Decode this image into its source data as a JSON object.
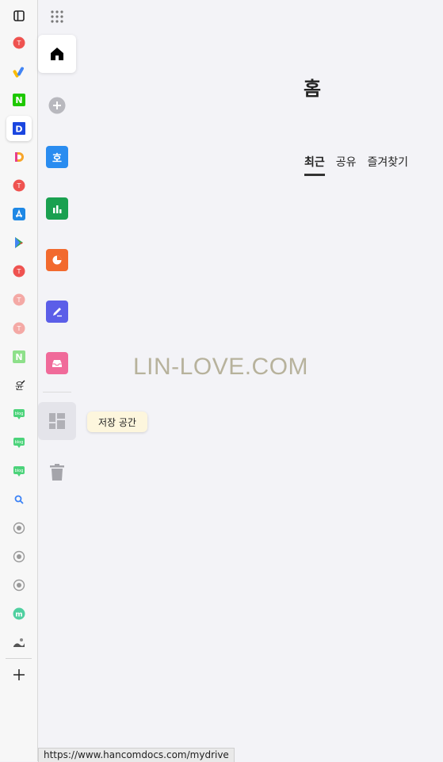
{
  "browser_sidebar": {
    "icons": [
      "sidebar-toggle-icon",
      "favicon-red-icon",
      "google-ads-icon",
      "naver-icon",
      "d-app-icon",
      "d-gradient-icon",
      "favicon-red-icon",
      "app-store-icon",
      "google-play-icon",
      "favicon-red-icon",
      "favicon-red-faded-icon",
      "favicon-red-faded-icon",
      "naver-faded-icon",
      "text-app-icon",
      "blog-icon",
      "blog-icon",
      "blog-icon",
      "search-icon",
      "radio-icon",
      "radio-icon",
      "radio-icon",
      "m-app-icon",
      "image-app-icon",
      "add-icon"
    ]
  },
  "app_rail": {
    "items": [
      {
        "name": "home",
        "color": "#000000"
      },
      {
        "name": "new",
        "color": "#b8b8be"
      },
      {
        "name": "hangul",
        "label": "호",
        "color": "#2a8cf0"
      },
      {
        "name": "hancell",
        "color": "#1aa050"
      },
      {
        "name": "hanshow",
        "color": "#f26a2e"
      },
      {
        "name": "note",
        "color": "#5b5ee8"
      },
      {
        "name": "inbox",
        "color": "#f06a9a"
      },
      {
        "name": "storage",
        "color": "#b0b0b6"
      },
      {
        "name": "trash",
        "color": "#a4a4aa"
      }
    ]
  },
  "tooltip": {
    "label": "저장 공간"
  },
  "page": {
    "title": "홈",
    "tabs": [
      {
        "label": "최근"
      },
      {
        "label": "공유"
      },
      {
        "label": "즐겨찾기"
      }
    ],
    "active_tab": "최근"
  },
  "watermark": {
    "text": "LIN-LOVE.COM"
  },
  "status_bar": {
    "url": "https://www.hancomdocs.com/mydrive"
  }
}
